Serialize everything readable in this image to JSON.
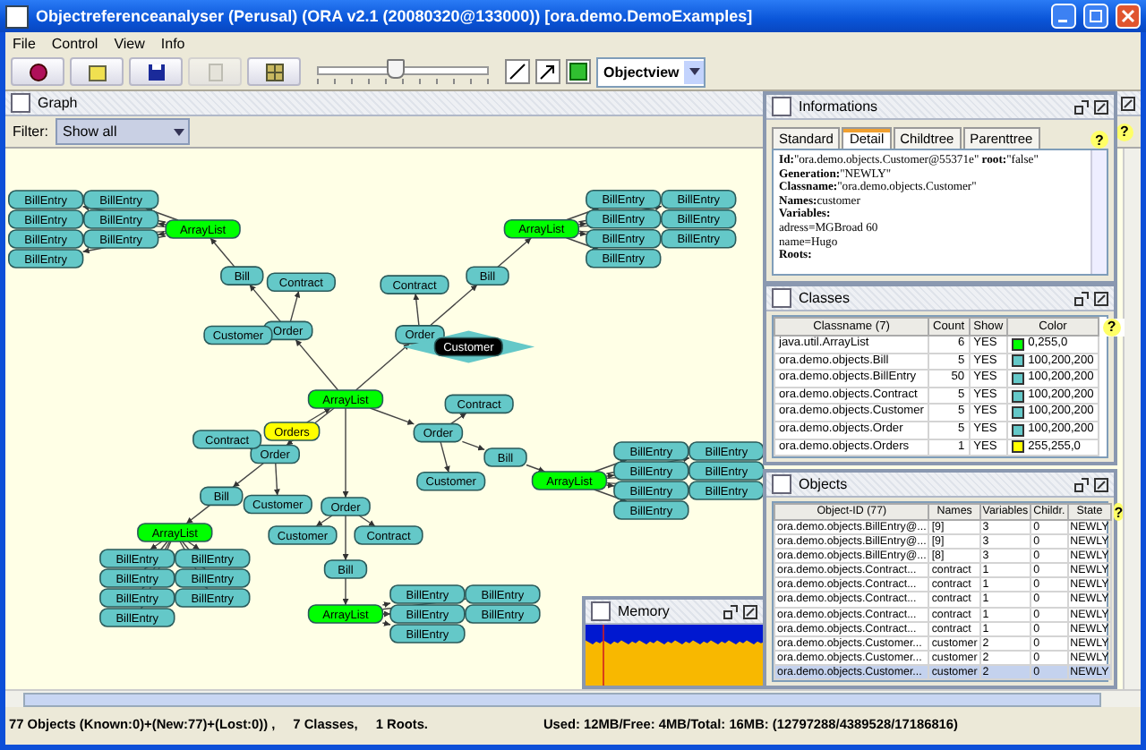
{
  "window": {
    "title": "Objectreferenceanalyser (Perusal) (ORA v2.1 (20080320@133000))    [ora.demo.DemoExamples]"
  },
  "menu": [
    "File",
    "Control",
    "View",
    "Info"
  ],
  "toolbar": {
    "buttons": [
      {
        "kind": "circle",
        "disabled": false
      },
      {
        "kind": "folder",
        "disabled": false
      },
      {
        "kind": "save",
        "disabled": false
      },
      {
        "kind": "page",
        "disabled": true
      },
      {
        "kind": "grid",
        "disabled": false
      }
    ],
    "zoom": {
      "level": 0.45
    },
    "tools": [
      {
        "kind": "line"
      },
      {
        "kind": "arrow"
      },
      {
        "kind": "square"
      }
    ],
    "view_select": "Objectview"
  },
  "graph": {
    "title": "Graph",
    "filter_label": "Filter:",
    "filter_value": "Show all",
    "help": "?",
    "root": {
      "label": "Orders",
      "color": "#ffff00",
      "selected": false,
      "children": [
        {
          "label": "ArrayList",
          "color": "#00ff00",
          "selected": false,
          "children": [
            {
              "label": "Order",
              "color": "#64c8c8",
              "selected": false,
              "children": [
                {
                  "label": "Customer",
                  "color": "#64c8c8",
                  "selected": false
                },
                {
                  "label": "Contract",
                  "color": "#64c8c8",
                  "selected": false
                },
                {
                  "label": "Bill",
                  "color": "#64c8c8",
                  "selected": false,
                  "children": [
                    {
                      "label": "ArrayList",
                      "color": "#00ff00",
                      "selected": false,
                      "children": [
                        {
                          "label": "BillEntry",
                          "color": "#64c8c8",
                          "selected": false
                        },
                        {
                          "label": "BillEntry",
                          "color": "#64c8c8",
                          "selected": false
                        },
                        {
                          "label": "BillEntry",
                          "color": "#64c8c8",
                          "selected": false
                        },
                        {
                          "label": "BillEntry",
                          "color": "#64c8c8",
                          "selected": false
                        },
                        {
                          "label": "BillEntry",
                          "color": "#64c8c8",
                          "selected": false
                        },
                        {
                          "label": "BillEntry",
                          "color": "#64c8c8",
                          "selected": false
                        },
                        {
                          "label": "BillEntry",
                          "color": "#64c8c8",
                          "selected": false
                        }
                      ]
                    }
                  ]
                }
              ]
            },
            {
              "label": "Order",
              "color": "#64c8c8",
              "selected": false,
              "children": [
                {
                  "label": "Contract",
                  "color": "#64c8c8",
                  "selected": false
                },
                {
                  "label": "Customer",
                  "color": "#64c8c8",
                  "selected": true
                },
                {
                  "label": "Bill",
                  "color": "#64c8c8",
                  "selected": false,
                  "children": [
                    {
                      "label": "ArrayList",
                      "color": "#00ff00",
                      "selected": false,
                      "children": [
                        {
                          "label": "BillEntry",
                          "color": "#64c8c8",
                          "selected": false
                        },
                        {
                          "label": "BillEntry",
                          "color": "#64c8c8",
                          "selected": false
                        },
                        {
                          "label": "BillEntry",
                          "color": "#64c8c8",
                          "selected": false
                        },
                        {
                          "label": "BillEntry",
                          "color": "#64c8c8",
                          "selected": false
                        },
                        {
                          "label": "BillEntry",
                          "color": "#64c8c8",
                          "selected": false
                        },
                        {
                          "label": "BillEntry",
                          "color": "#64c8c8",
                          "selected": false
                        },
                        {
                          "label": "BillEntry",
                          "color": "#64c8c8",
                          "selected": false
                        }
                      ]
                    }
                  ]
                }
              ]
            },
            {
              "label": "Order",
              "color": "#64c8c8",
              "selected": false,
              "children": [
                {
                  "label": "Contract",
                  "color": "#64c8c8",
                  "selected": false
                },
                {
                  "label": "Customer",
                  "color": "#64c8c8",
                  "selected": false
                },
                {
                  "label": "Bill",
                  "color": "#64c8c8",
                  "selected": false,
                  "children": [
                    {
                      "label": "ArrayList",
                      "color": "#00ff00",
                      "selected": false,
                      "children": [
                        {
                          "label": "BillEntry",
                          "color": "#64c8c8",
                          "selected": false
                        },
                        {
                          "label": "BillEntry",
                          "color": "#64c8c8",
                          "selected": false
                        },
                        {
                          "label": "BillEntry",
                          "color": "#64c8c8",
                          "selected": false
                        },
                        {
                          "label": "BillEntry",
                          "color": "#64c8c8",
                          "selected": false
                        },
                        {
                          "label": "BillEntry",
                          "color": "#64c8c8",
                          "selected": false
                        },
                        {
                          "label": "BillEntry",
                          "color": "#64c8c8",
                          "selected": false
                        },
                        {
                          "label": "BillEntry",
                          "color": "#64c8c8",
                          "selected": false
                        }
                      ]
                    }
                  ]
                }
              ]
            },
            {
              "label": "Order",
              "color": "#64c8c8",
              "selected": false,
              "children": [
                {
                  "label": "Contract",
                  "color": "#64c8c8",
                  "selected": false
                },
                {
                  "label": "Customer",
                  "color": "#64c8c8",
                  "selected": false
                },
                {
                  "label": "Bill",
                  "color": "#64c8c8",
                  "selected": false,
                  "children": [
                    {
                      "label": "ArrayList",
                      "color": "#00ff00",
                      "selected": false,
                      "children": [
                        {
                          "label": "BillEntry",
                          "color": "#64c8c8",
                          "selected": false
                        },
                        {
                          "label": "BillEntry",
                          "color": "#64c8c8",
                          "selected": false
                        },
                        {
                          "label": "BillEntry",
                          "color": "#64c8c8",
                          "selected": false
                        },
                        {
                          "label": "BillEntry",
                          "color": "#64c8c8",
                          "selected": false
                        },
                        {
                          "label": "BillEntry",
                          "color": "#64c8c8",
                          "selected": false
                        }
                      ]
                    }
                  ]
                }
              ]
            },
            {
              "label": "Order",
              "color": "#64c8c8",
              "selected": false,
              "children": [
                {
                  "label": "Customer",
                  "color": "#64c8c8",
                  "selected": false
                },
                {
                  "label": "Contract",
                  "color": "#64c8c8",
                  "selected": false
                },
                {
                  "label": "Bill",
                  "color": "#64c8c8",
                  "selected": false,
                  "children": [
                    {
                      "label": "ArrayList",
                      "color": "#00ff00",
                      "selected": false,
                      "children": [
                        {
                          "label": "BillEntry",
                          "color": "#64c8c8",
                          "selected": false
                        },
                        {
                          "label": "BillEntry",
                          "color": "#64c8c8",
                          "selected": false
                        },
                        {
                          "label": "BillEntry",
                          "color": "#64c8c8",
                          "selected": false
                        },
                        {
                          "label": "BillEntry",
                          "color": "#64c8c8",
                          "selected": false
                        },
                        {
                          "label": "BillEntry",
                          "color": "#64c8c8",
                          "selected": false
                        },
                        {
                          "label": "BillEntry",
                          "color": "#64c8c8",
                          "selected": false
                        },
                        {
                          "label": "BillEntry",
                          "color": "#64c8c8",
                          "selected": false
                        }
                      ]
                    }
                  ]
                }
              ]
            }
          ]
        }
      ]
    }
  },
  "memory": {
    "title": "Memory"
  },
  "informations": {
    "title": "Informations",
    "help": "?",
    "tabs": [
      {
        "label": "Standard",
        "selected": false
      },
      {
        "label": "Detail",
        "selected": true
      },
      {
        "label": "Childtree",
        "selected": false
      },
      {
        "label": "Parenttree",
        "selected": false
      }
    ],
    "lines": [
      {
        "kind": "text",
        "text": "**Id:**\"ora.demo.objects.Customer@55371e\" **root:**\"false\""
      },
      {
        "kind": "text",
        "text": "**Generation:**\"NEWLY\""
      },
      {
        "kind": "text",
        "text": "**Classname:**\"ora.demo.objects.Customer\""
      },
      {
        "kind": "text",
        "text": "**Names:**customer"
      },
      {
        "kind": "heading",
        "text": "Variables:"
      },
      {
        "kind": "text",
        "text": "adress=MGBroad 60"
      },
      {
        "kind": "text",
        "text": "name=Hugo"
      },
      {
        "kind": "heading",
        "text": "Roots:"
      }
    ]
  },
  "classes": {
    "title": "Classes",
    "help": "?",
    "columns": [
      "Classname (7)",
      "Count",
      "Show",
      "Color"
    ],
    "rows": [
      {
        "name": "java.util.ArrayList",
        "count": "6",
        "show": "YES",
        "color": "#00ff00",
        "color_value": "0,255,0"
      },
      {
        "name": "ora.demo.objects.Bill",
        "count": "5",
        "show": "YES",
        "color": "#64c8c8",
        "color_value": "100,200,200"
      },
      {
        "name": "ora.demo.objects.BillEntry",
        "count": "50",
        "show": "YES",
        "color": "#64c8c8",
        "color_value": "100,200,200"
      },
      {
        "name": "ora.demo.objects.Contract",
        "count": "5",
        "show": "YES",
        "color": "#64c8c8",
        "color_value": "100,200,200"
      },
      {
        "name": "ora.demo.objects.Customer",
        "count": "5",
        "show": "YES",
        "color": "#64c8c8",
        "color_value": "100,200,200"
      },
      {
        "name": "ora.demo.objects.Order",
        "count": "5",
        "show": "YES",
        "color": "#64c8c8",
        "color_value": "100,200,200"
      },
      {
        "name": "ora.demo.objects.Orders",
        "count": "1",
        "show": "YES",
        "color": "#ffff00",
        "color_value": "255,255,0"
      }
    ]
  },
  "objects": {
    "title": "Objects",
    "help": "?",
    "columns": [
      "Object-ID (77)",
      "Names",
      "Variables",
      "Childr.",
      "State"
    ],
    "rows": [
      {
        "cells": [
          "ora.demo.objects.BillEntry@...",
          "[9]",
          "3",
          "0",
          "NEWLY"
        ],
        "selected": false
      },
      {
        "cells": [
          "ora.demo.objects.BillEntry@...",
          "[9]",
          "3",
          "0",
          "NEWLY"
        ],
        "selected": false
      },
      {
        "cells": [
          "ora.demo.objects.BillEntry@...",
          "[8]",
          "3",
          "0",
          "NEWLY"
        ],
        "selected": false
      },
      {
        "cells": [
          "ora.demo.objects.Contract...",
          "contract",
          "1",
          "0",
          "NEWLY"
        ],
        "selected": false
      },
      {
        "cells": [
          "ora.demo.objects.Contract...",
          "contract",
          "1",
          "0",
          "NEWLY"
        ],
        "selected": false
      },
      {
        "cells": [
          "ora.demo.objects.Contract...",
          "contract",
          "1",
          "0",
          "NEWLY"
        ],
        "selected": false
      },
      {
        "cells": [
          "ora.demo.objects.Contract...",
          "contract",
          "1",
          "0",
          "NEWLY"
        ],
        "selected": false
      },
      {
        "cells": [
          "ora.demo.objects.Contract...",
          "contract",
          "1",
          "0",
          "NEWLY"
        ],
        "selected": false
      },
      {
        "cells": [
          "ora.demo.objects.Customer...",
          "customer",
          "2",
          "0",
          "NEWLY"
        ],
        "selected": false
      },
      {
        "cells": [
          "ora.demo.objects.Customer...",
          "customer",
          "2",
          "0",
          "NEWLY"
        ],
        "selected": false
      },
      {
        "cells": [
          "ora.demo.objects.Customer...",
          "customer",
          "2",
          "0",
          "NEWLY"
        ],
        "selected": true
      }
    ]
  },
  "status_bar": {
    "objects": "77 Objects (Known:0)+(New:77)+(Lost:0)) ,",
    "classes": "7 Classes,",
    "roots": "1 Roots.",
    "memory": "Used: 12MB/Free: 4MB/Total: 16MB: (12797288/4389528/17186816)"
  }
}
